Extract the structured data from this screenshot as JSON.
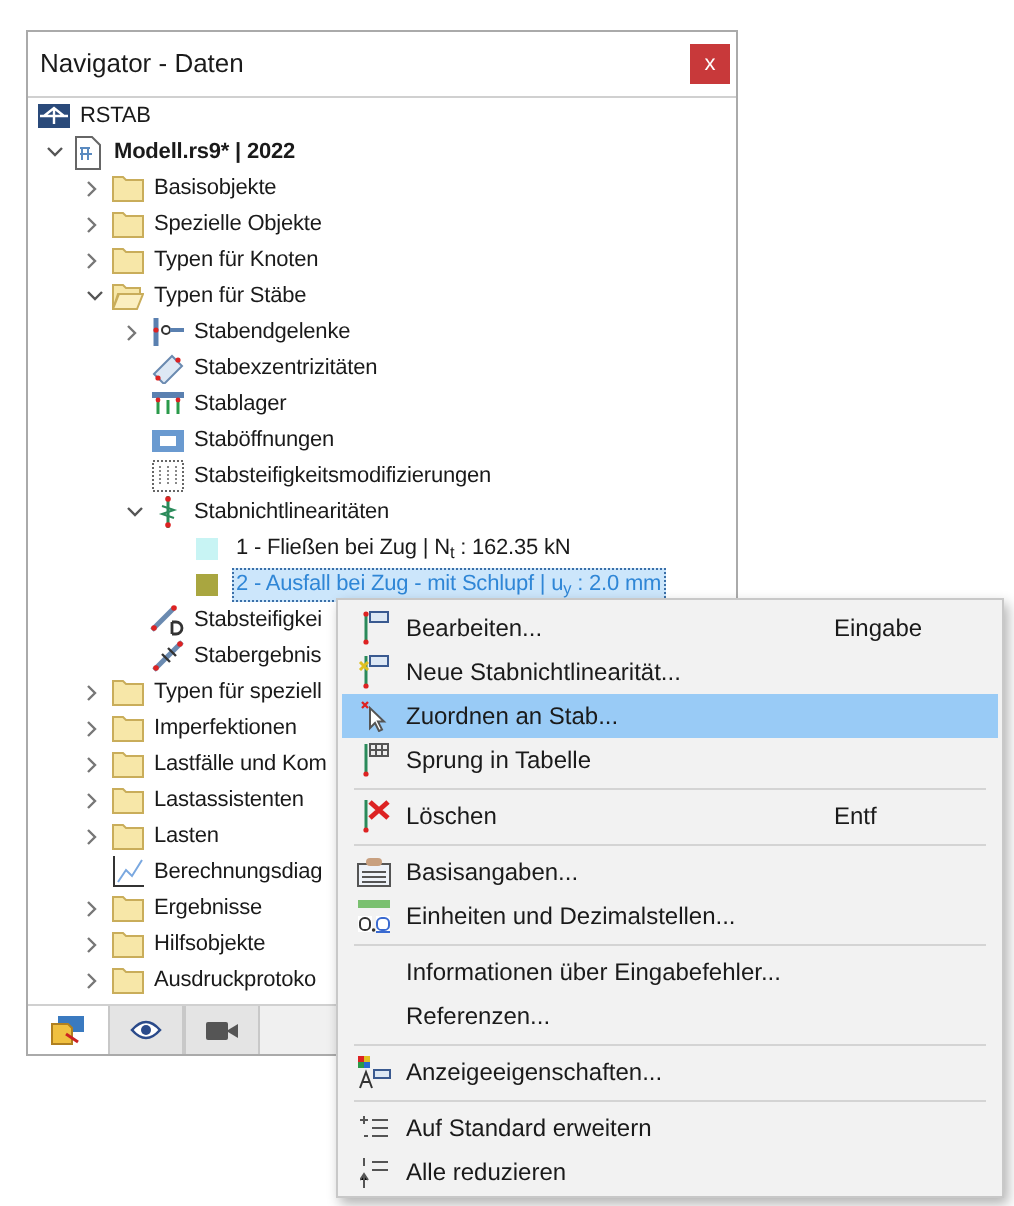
{
  "window": {
    "title": "Navigator - Daten",
    "close": "x"
  },
  "tree": [
    {
      "label": "RSTAB",
      "kind": "app",
      "children": [
        {
          "label": "Modell.rs9* | 2022",
          "kind": "file",
          "bold": true,
          "expanded": true,
          "children": [
            {
              "label": "Basisobjekte",
              "kind": "folder",
              "expanded": false
            },
            {
              "label": "Spezielle Objekte",
              "kind": "folder",
              "expanded": false
            },
            {
              "label": "Typen für Knoten",
              "kind": "folder",
              "expanded": false
            },
            {
              "label": "Typen für Stäbe",
              "kind": "folder",
              "expanded": true,
              "children": [
                {
                  "label": "Stabendgelenke",
                  "kind": "hinge",
                  "expanded": false
                },
                {
                  "label": "Stabexzentrizitäten",
                  "kind": "eccentricity"
                },
                {
                  "label": "Stablager",
                  "kind": "support"
                },
                {
                  "label": "Staböffnungen",
                  "kind": "opening"
                },
                {
                  "label": "Stabsteifigkeitsmodifizierungen",
                  "kind": "grid"
                },
                {
                  "label": "Stabnichtlinearitäten",
                  "kind": "nonlinear",
                  "expanded": true,
                  "children": [
                    {
                      "label": "1 - Fließen bei Zug | N$_{t}$ : 162.35 kN",
                      "kind": "swatch",
                      "color": "#c8f4f4",
                      "selected": false
                    },
                    {
                      "label": "2 - Ausfall bei Zug - mit Schlupf | u$_{y}$ : 2.0 mm",
                      "kind": "swatch",
                      "color": "#a9a640",
                      "selected": true
                    }
                  ]
                },
                {
                  "label": "Stabsteifigkei",
                  "kind": "stiffness"
                },
                {
                  "label": "Stabergebnis",
                  "kind": "results"
                }
              ]
            },
            {
              "label": "Typen für speziell",
              "kind": "folder",
              "expanded": false
            },
            {
              "label": "Imperfektionen",
              "kind": "folder",
              "expanded": false
            },
            {
              "label": "Lastfälle und Kom",
              "kind": "folder",
              "expanded": false
            },
            {
              "label": "Lastassistenten",
              "kind": "folder",
              "expanded": false
            },
            {
              "label": "Lasten",
              "kind": "folder",
              "expanded": false
            },
            {
              "label": "Berechnungsdiag",
              "kind": "diagram"
            },
            {
              "label": "Ergebnisse",
              "kind": "folder",
              "expanded": false
            },
            {
              "label": "Hilfsobjekte",
              "kind": "folder",
              "expanded": false
            },
            {
              "label": "Ausdruckprotoko",
              "kind": "folder",
              "expanded": false
            }
          ]
        }
      ]
    }
  ],
  "bottom_tabs": [
    {
      "kind": "data",
      "selected": true
    },
    {
      "kind": "view",
      "selected": false
    },
    {
      "kind": "camera",
      "selected": false
    }
  ],
  "context_menu": [
    {
      "kind": "item",
      "label": "Bearbeiten...",
      "shortcut": "Eingabe",
      "selected": false
    },
    {
      "kind": "item",
      "label": "Neue Stabnichtlinearität...",
      "selected": false
    },
    {
      "kind": "item",
      "label": "Zuordnen an Stab...",
      "selected": true
    },
    {
      "kind": "item",
      "label": "Sprung in Tabelle",
      "selected": false
    },
    {
      "kind": "separator"
    },
    {
      "kind": "item",
      "label": "Löschen",
      "shortcut": "Entf",
      "selected": false
    },
    {
      "kind": "separator"
    },
    {
      "kind": "item",
      "label": "Basisangaben...",
      "selected": false
    },
    {
      "kind": "item",
      "label": "Einheiten und Dezimalstellen...",
      "selected": false
    },
    {
      "kind": "separator"
    },
    {
      "kind": "item",
      "label": "Informationen über Eingabefehler...",
      "selected": false
    },
    {
      "kind": "item",
      "label": "Referenzen...",
      "selected": false
    },
    {
      "kind": "separator"
    },
    {
      "kind": "item",
      "label": "Anzeigeeigenschaften...",
      "selected": false
    },
    {
      "kind": "separator"
    },
    {
      "kind": "item",
      "label": "Auf Standard erweitern",
      "selected": false
    },
    {
      "kind": "item",
      "label": "Alle reduzieren",
      "selected": false
    }
  ]
}
